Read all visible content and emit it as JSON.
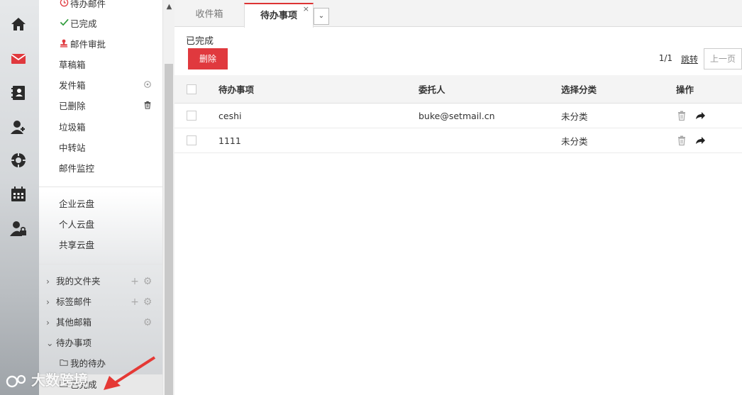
{
  "rail": {
    "icons": [
      "home-icon",
      "mail-icon",
      "contacts-icon",
      "add-user-icon",
      "settings-icon",
      "calendar-icon",
      "user-lock-icon"
    ],
    "active_color": "#e0393e"
  },
  "sidebar": {
    "mail_items": [
      {
        "label": "待办邮件",
        "icon": "clock-icon"
      },
      {
        "label": "已完成",
        "icon": "check-icon"
      },
      {
        "label": "邮件审批",
        "icon": "stamp-icon"
      },
      {
        "label": "草稿箱"
      },
      {
        "label": "发件箱"
      },
      {
        "label": "已删除"
      },
      {
        "label": "垃圾箱"
      },
      {
        "label": "中转站"
      },
      {
        "label": "邮件监控"
      }
    ],
    "cloud_items": [
      "企业云盘",
      "个人云盘",
      "共享云盘"
    ],
    "groups": [
      {
        "label": "我的文件夹"
      },
      {
        "label": "标签邮件"
      },
      {
        "label": "其他邮箱"
      },
      {
        "label": "待办事项"
      }
    ],
    "todo_children": [
      "我的待办",
      "已完成"
    ]
  },
  "tabs": {
    "inbox": "收件箱",
    "todo": "待办事项",
    "close": "×",
    "more": "⌄"
  },
  "toolbar": {
    "subtitle": "已完成",
    "delete_label": "删除",
    "page_info": "1/1",
    "jump_label": "跳转",
    "prev_label": "上一页"
  },
  "table": {
    "columns": [
      "待办事项",
      "委托人",
      "选择分类",
      "操作"
    ],
    "rows": [
      {
        "item": "ceshi",
        "delegate": "buke@setmail.cn",
        "category": "未分类"
      },
      {
        "item": "1111",
        "delegate": "",
        "category": "未分类"
      }
    ]
  },
  "watermark": {
    "text": "大数跨境"
  },
  "colors": {
    "accent": "#e0393e",
    "check": "#2e9b3a"
  }
}
